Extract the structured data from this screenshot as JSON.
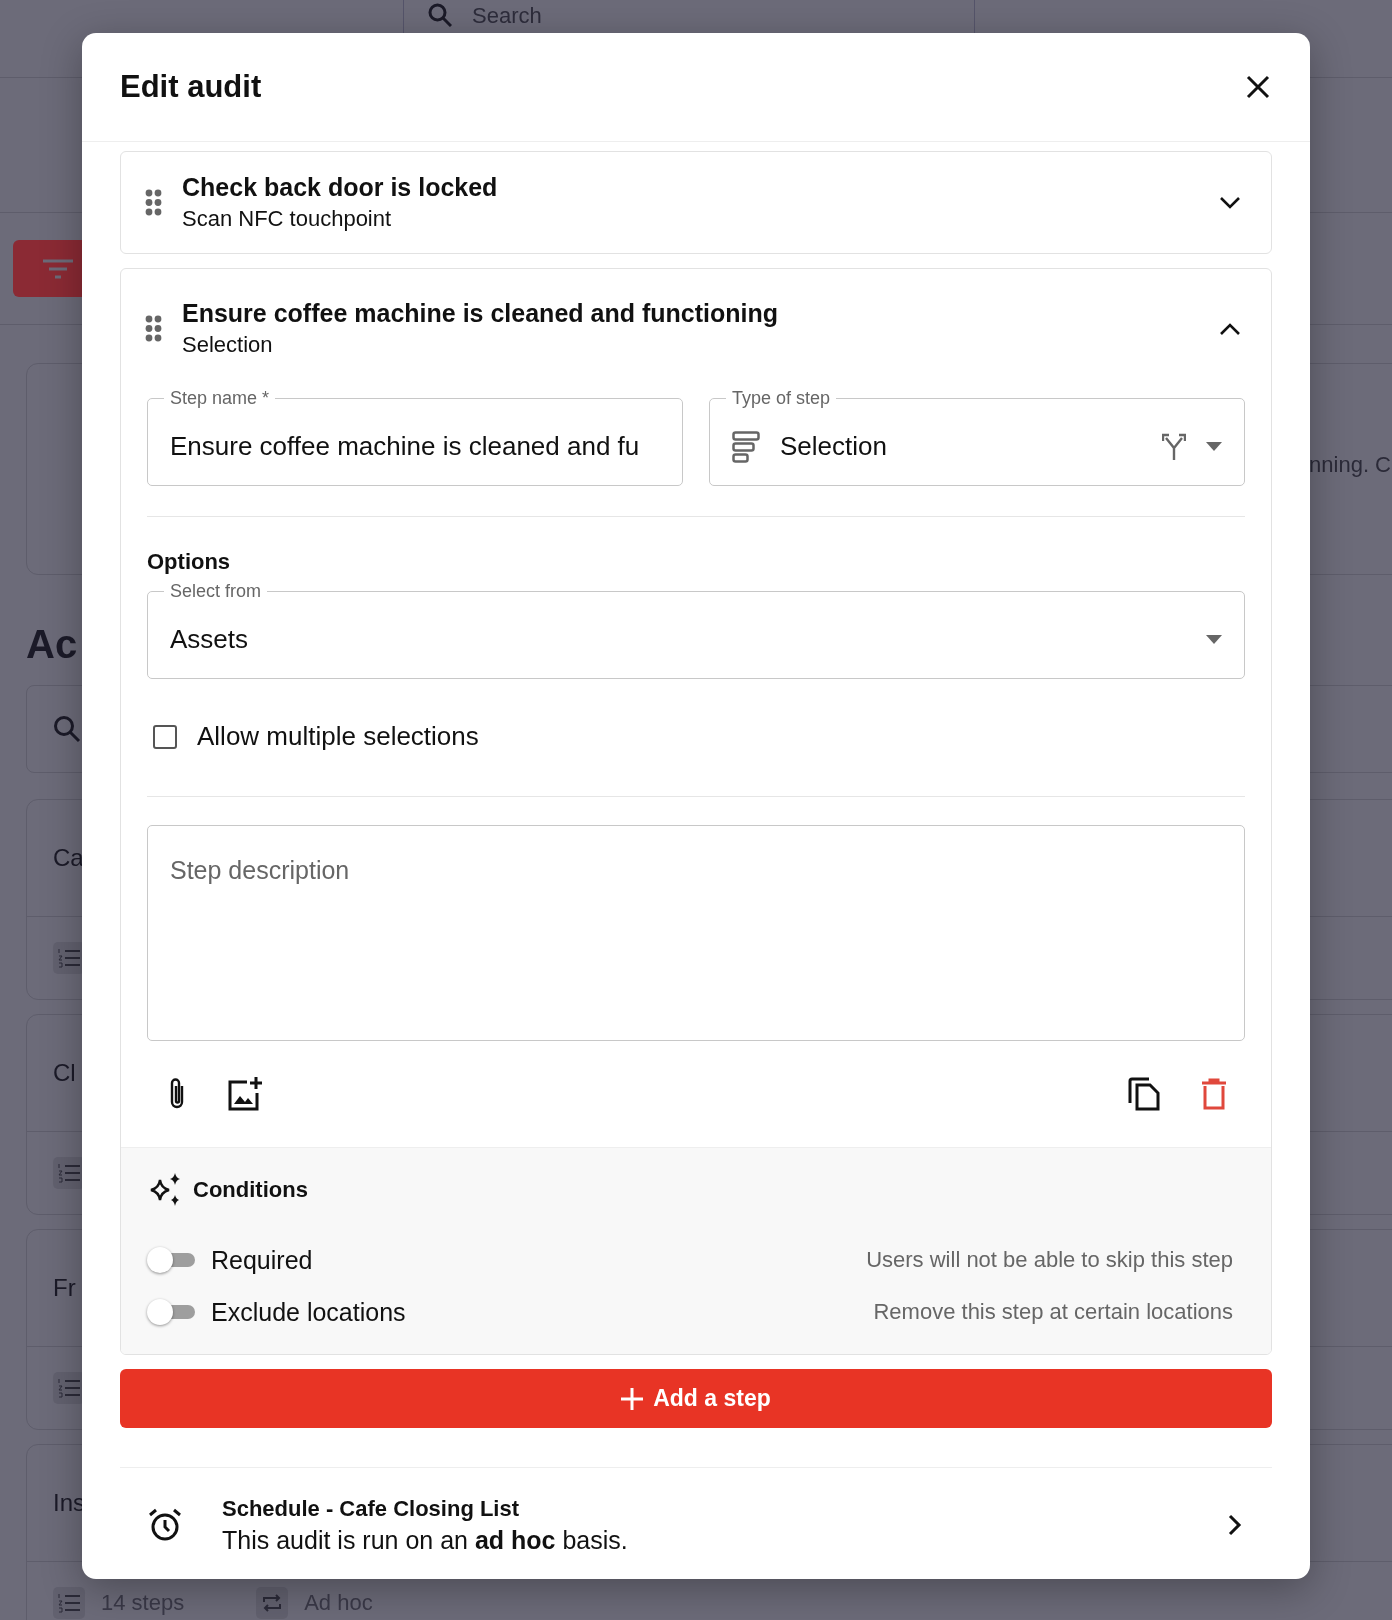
{
  "background": {
    "search": {
      "placeholder": "Search"
    },
    "snippet": "nning. C",
    "heading": "Ac",
    "cards": [
      {
        "title": "Ca"
      },
      {
        "title": "Cl"
      },
      {
        "title": "Fr"
      },
      {
        "title": "Ins",
        "steps": "14 steps",
        "frequency": "Ad hoc"
      }
    ]
  },
  "dialog": {
    "title": "Edit audit",
    "steps": [
      {
        "title": "Check back door is locked",
        "type": "Scan NFC touchpoint",
        "expanded": false
      },
      {
        "title": "Ensure coffee machine is cleaned and functioning",
        "type": "Selection",
        "expanded": true,
        "editor": {
          "step_name": {
            "label": "Step name *",
            "value": "Ensure coffee machine is cleaned and fu"
          },
          "type_of_step": {
            "label": "Type of step",
            "value": "Selection"
          },
          "options_heading": "Options",
          "select_from": {
            "label": "Select from",
            "value": "Assets"
          },
          "allow_multiple": {
            "label": "Allow multiple selections",
            "checked": false
          },
          "description": {
            "placeholder": "Step description"
          },
          "conditions": {
            "title": "Conditions",
            "items": [
              {
                "label": "Required",
                "hint": "Users will not be able to skip this step",
                "on": false
              },
              {
                "label": "Exclude locations",
                "hint": "Remove this step at certain locations",
                "on": false
              }
            ]
          }
        }
      }
    ],
    "add_step": "Add a step",
    "schedule": {
      "title": "Schedule - Cafe Closing List",
      "text": "This audit is run on an **ad hoc** basis."
    }
  }
}
